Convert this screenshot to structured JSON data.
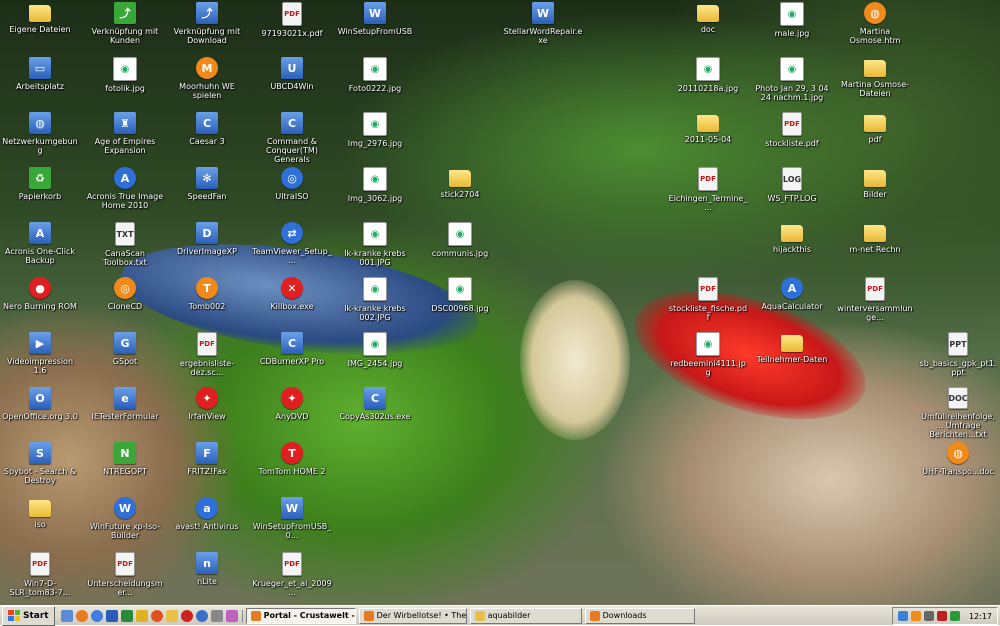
{
  "desktop_icons": [
    {
      "label": "Eigene Dateien",
      "kind": "folder",
      "glyph": ""
    },
    {
      "label": "Arbeitsplatz",
      "kind": "exe",
      "glyph": "▭"
    },
    {
      "label": "Netzwerkumgebung",
      "kind": "exe",
      "glyph": "◍"
    },
    {
      "label": "Papierkorb",
      "kind": "green",
      "glyph": "♻"
    },
    {
      "label": "Acronis One-Click Backup",
      "kind": "exe",
      "glyph": "A"
    },
    {
      "label": "Nero Burning ROM",
      "kind": "red",
      "glyph": "●"
    },
    {
      "label": "Videoimpression 1.6",
      "kind": "exe",
      "glyph": "▶"
    },
    {
      "label": "OpenOffice.org 3.0",
      "kind": "exe",
      "glyph": "O"
    },
    {
      "label": "Spybot - Search & Destroy",
      "kind": "exe",
      "glyph": "S"
    },
    {
      "label": "iso",
      "kind": "folder",
      "glyph": ""
    },
    {
      "label": "Win7-D-SLR_tom83-7...",
      "kind": "pdf",
      "glyph": "PDF"
    },
    {
      "label": "Verknüpfung mit Kunden",
      "kind": "green",
      "glyph": "⤴"
    },
    {
      "label": "fotolik.jpg",
      "kind": "img",
      "glyph": "◉"
    },
    {
      "label": "Age of Empires Expansion",
      "kind": "exe",
      "glyph": "♜"
    },
    {
      "label": "Acronis True Image Home 2010",
      "kind": "blue",
      "glyph": "A"
    },
    {
      "label": "CanaScan Toolbox.txt",
      "kind": "doc",
      "glyph": "TXT"
    },
    {
      "label": "CloneCD",
      "kind": "orange",
      "glyph": "◎"
    },
    {
      "label": "GSpot",
      "kind": "exe",
      "glyph": "G"
    },
    {
      "label": "IETesterFormular",
      "kind": "exe",
      "glyph": "e"
    },
    {
      "label": "NTREGOPT",
      "kind": "green",
      "glyph": "N"
    },
    {
      "label": "WinFuture xp-Iso-Builder",
      "kind": "blue",
      "glyph": "W"
    },
    {
      "label": "Unterscheidungsmer...",
      "kind": "pdf",
      "glyph": "PDF"
    },
    {
      "label": "Verknüpfung mit Download",
      "kind": "exe",
      "glyph": "⤴"
    },
    {
      "label": "Moorhuhn WE spielen",
      "kind": "orange",
      "glyph": "M"
    },
    {
      "label": "Caesar 3",
      "kind": "exe",
      "glyph": "C"
    },
    {
      "label": "SpeedFan",
      "kind": "exe",
      "glyph": "✻"
    },
    {
      "label": "DriverImageXP",
      "kind": "exe",
      "glyph": "D"
    },
    {
      "label": "Tomb002",
      "kind": "orange",
      "glyph": "T"
    },
    {
      "label": "ergebnisliste-dez.sc...",
      "kind": "pdf",
      "glyph": "PDF"
    },
    {
      "label": "IrfanView",
      "kind": "red",
      "glyph": "✦"
    },
    {
      "label": "FRITZ!Fax",
      "kind": "exe",
      "glyph": "F"
    },
    {
      "label": "avast! Antivirus",
      "kind": "blue",
      "glyph": "a"
    },
    {
      "label": "nLite",
      "kind": "exe",
      "glyph": "n"
    },
    {
      "label": "97193021x.pdf",
      "kind": "pdf",
      "glyph": "PDF"
    },
    {
      "label": "UBCD4Win",
      "kind": "exe",
      "glyph": "U"
    },
    {
      "label": "Command & Conquer(TM) Generals",
      "kind": "exe",
      "glyph": "C"
    },
    {
      "label": "UltraISO",
      "kind": "blue",
      "glyph": "◎"
    },
    {
      "label": "TeamViewer_Setup_...",
      "kind": "blue",
      "glyph": "⇄"
    },
    {
      "label": "Killbox.exe",
      "kind": "red",
      "glyph": "✕"
    },
    {
      "label": "CDBurnerXP Pro",
      "kind": "exe",
      "glyph": "C"
    },
    {
      "label": "AnyDVD",
      "kind": "red",
      "glyph": "✦"
    },
    {
      "label": "TomTom HOME 2",
      "kind": "red",
      "glyph": "T"
    },
    {
      "label": "WinSetupFromUSB_0...",
      "kind": "exe",
      "glyph": "W"
    },
    {
      "label": "Krueger_et_al_2009...",
      "kind": "pdf",
      "glyph": "PDF"
    },
    {
      "label": "WinSetupFromUSB",
      "kind": "exe",
      "glyph": "W"
    },
    {
      "label": "Foto0222.jpg",
      "kind": "img",
      "glyph": "◉"
    },
    {
      "label": "Img_2976.jpg",
      "kind": "img",
      "glyph": "◉"
    },
    {
      "label": "Img_3062.jpg",
      "kind": "img",
      "glyph": "◉"
    },
    {
      "label": "lk-kranke krebs 001.JPG",
      "kind": "img",
      "glyph": "◉"
    },
    {
      "label": "lk-kranke krebs 002.JPG",
      "kind": "img",
      "glyph": "◉"
    },
    {
      "label": "IMG_2454.jpg",
      "kind": "img",
      "glyph": "◉"
    },
    {
      "label": "CopyAs302us.exe",
      "kind": "exe",
      "glyph": "C"
    },
    {
      "label": "stick2704",
      "kind": "folder",
      "glyph": ""
    },
    {
      "label": "communis.jpg",
      "kind": "img",
      "glyph": "◉"
    },
    {
      "label": "DSC00968.jpg",
      "kind": "img",
      "glyph": "◉"
    },
    {
      "label": "StellarWordRepair.exe",
      "kind": "exe",
      "glyph": "W"
    },
    {
      "label": "doc",
      "kind": "folder",
      "glyph": ""
    },
    {
      "label": "20110218a.jpg",
      "kind": "img",
      "glyph": "◉"
    },
    {
      "label": "2011-05-04",
      "kind": "folder",
      "glyph": ""
    },
    {
      "label": "Elchingen_Termine_...",
      "kind": "pdf",
      "glyph": "PDF"
    },
    {
      "label": "stockliste_fische.pdf",
      "kind": "pdf",
      "glyph": "PDF"
    },
    {
      "label": "redbeemini4111.jpg",
      "kind": "img",
      "glyph": "◉"
    },
    {
      "label": "male.jpg",
      "kind": "img",
      "glyph": "◉"
    },
    {
      "label": "Photo Jan 29, 3 04 24 nachm.1.jpg",
      "kind": "img",
      "glyph": "◉"
    },
    {
      "label": "stockliste.pdf",
      "kind": "pdf",
      "glyph": "PDF"
    },
    {
      "label": "WS_FTP.LOG",
      "kind": "doc",
      "glyph": "LOG"
    },
    {
      "label": "hijackthis",
      "kind": "folder",
      "glyph": ""
    },
    {
      "label": "AquaCalculator",
      "kind": "blue",
      "glyph": "A"
    },
    {
      "label": "Teilnehmer-Daten",
      "kind": "folder",
      "glyph": ""
    },
    {
      "label": "Martina Osmose.htm",
      "kind": "orange",
      "glyph": "◍"
    },
    {
      "label": "Martina Osmose-Dateien",
      "kind": "folder",
      "glyph": ""
    },
    {
      "label": "pdf",
      "kind": "folder",
      "glyph": ""
    },
    {
      "label": "Bilder",
      "kind": "folder",
      "glyph": ""
    },
    {
      "label": "m-net Rechn",
      "kind": "folder",
      "glyph": ""
    },
    {
      "label": "winterversammlunge...",
      "kind": "pdf",
      "glyph": "PDF"
    },
    {
      "label": "sb_basics_gpk_pt1.ppt",
      "kind": "doc",
      "glyph": "PPT"
    },
    {
      "label": "Umfüllreihenfolge, ... Umfrage Berichten...txt",
      "kind": "doc",
      "glyph": "DOC"
    },
    {
      "label": "UHF-Transpo...doc",
      "kind": "orange",
      "glyph": "◍"
    }
  ],
  "taskbar": {
    "start_label": "Start",
    "tasks": [
      {
        "label": "Portal - Crustawelt - ...",
        "color": "#e87a22",
        "active": true
      },
      {
        "label": "Der Wirbellotse! • Them...",
        "color": "#e87a22",
        "active": false
      },
      {
        "label": "aquabilder",
        "color": "#e8c04a",
        "active": false
      },
      {
        "label": "Downloads",
        "color": "#e87a22",
        "active": false
      }
    ],
    "clock": "12:17"
  }
}
